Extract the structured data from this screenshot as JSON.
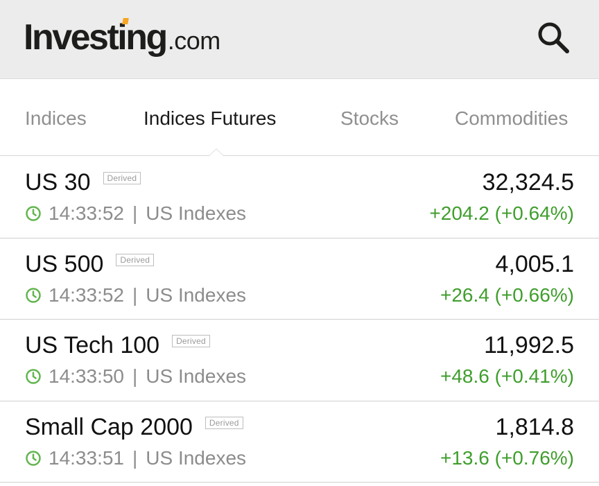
{
  "header": {
    "logo_main": "Investing",
    "logo_suffix": ".com",
    "search_icon": "search-icon"
  },
  "tabs": [
    {
      "label": "Indices",
      "active": false
    },
    {
      "label": "Indices Futures",
      "active": true
    },
    {
      "label": "Stocks",
      "active": false
    },
    {
      "label": "Commodities",
      "active": false
    }
  ],
  "rows": [
    {
      "name": "US 30",
      "badge": "Derived",
      "time": "14:33:52",
      "source": "US Indexes",
      "price": "32,324.5",
      "change": "+204.2 (+0.64%)"
    },
    {
      "name": "US 500",
      "badge": "Derived",
      "time": "14:33:52",
      "source": "US Indexes",
      "price": "4,005.1",
      "change": "+26.4 (+0.66%)"
    },
    {
      "name": "US Tech 100",
      "badge": "Derived",
      "time": "14:33:50",
      "source": "US Indexes",
      "price": "11,992.5",
      "change": "+48.6 (+0.41%)"
    },
    {
      "name": "Small Cap 2000",
      "badge": "Derived",
      "time": "14:33:51",
      "source": "US Indexes",
      "price": "1,814.8",
      "change": "+13.6 (+0.76%)"
    }
  ],
  "separator": "|",
  "colors": {
    "header_bg": "#ececec",
    "positive": "#3f9e2c",
    "clock": "#62b54f",
    "logo_accent": "#f6a623"
  }
}
